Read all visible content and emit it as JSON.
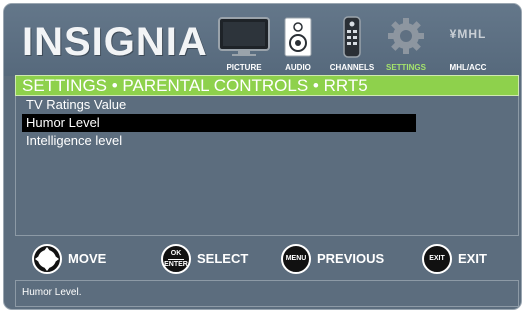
{
  "brand": {
    "logo_text": "INSIGNIA"
  },
  "nav": {
    "items": [
      {
        "label": "PICTURE",
        "icon": "tv-icon",
        "active": false
      },
      {
        "label": "AUDIO",
        "icon": "speaker-icon",
        "active": false
      },
      {
        "label": "CHANNELS",
        "icon": "remote-icon",
        "active": false
      },
      {
        "label": "SETTINGS",
        "icon": "gear-icon",
        "active": true
      },
      {
        "label": "MHL/ACC",
        "icon": "mhl-icon",
        "active": false,
        "icon_text": "¥MHL"
      }
    ]
  },
  "breadcrumb": "SETTINGS • PARENTAL CONTROLS • RRT5",
  "menu": {
    "items": [
      {
        "label": "TV Ratings Value"
      },
      {
        "label": "Humor Level",
        "selected": true
      },
      {
        "label": "Intelligence level"
      }
    ]
  },
  "controls": {
    "move": {
      "label": "MOVE"
    },
    "select": {
      "label": "SELECT",
      "btn_top": "OK",
      "btn_bottom": "ENTER"
    },
    "previous": {
      "label": "PREVIOUS",
      "btn": "MENU"
    },
    "exit": {
      "label": "EXIT",
      "btn": "EXIT"
    }
  },
  "status_text": "Humor Level.",
  "colors": {
    "accent_green": "#8ed14c",
    "active_label": "#a4e36c",
    "background": "#5c6d7e"
  }
}
